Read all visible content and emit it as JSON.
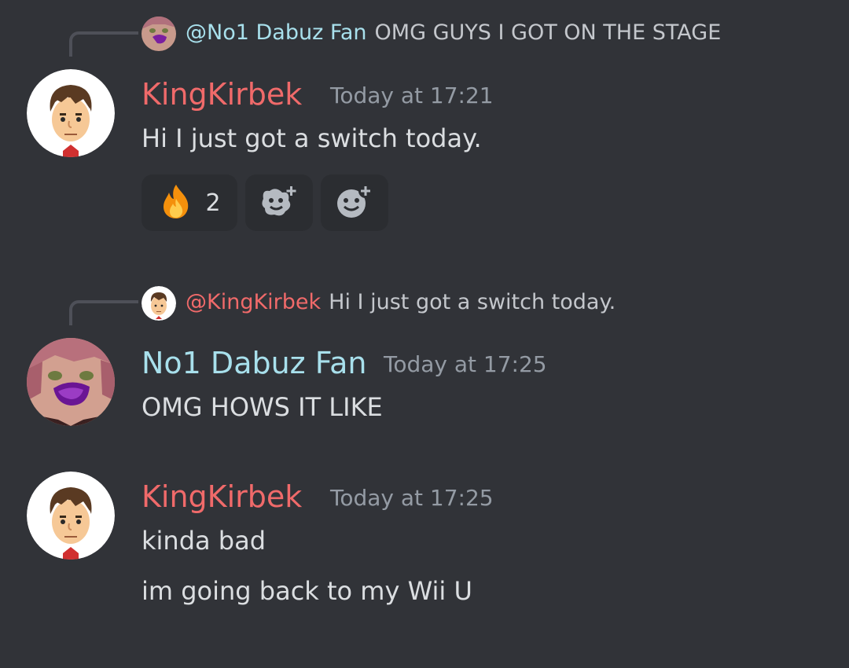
{
  "colors": {
    "background": "#313338",
    "kingkirbek_name": "#f06a6a",
    "dabuz_name": "#a8e0ec",
    "timestamp": "#949ba4",
    "message_text": "#dbdee1"
  },
  "messages": [
    {
      "reply": {
        "mention": "@No1 Dabuz Fan",
        "content": "OMG GUYS I GOT ON THE STAGE",
        "avatar_icon": "dabuz-fan-avatar"
      },
      "author": "KingKirbek",
      "timestamp": "Today at 17:21",
      "lines": [
        "Hi I just got a switch today."
      ],
      "avatar_icon": "mii-avatar",
      "reactions": [
        {
          "icon": "fire-emoji",
          "count": "2"
        },
        {
          "icon": "add-super-reaction-icon",
          "count": ""
        },
        {
          "icon": "add-reaction-icon",
          "count": ""
        }
      ]
    },
    {
      "reply": {
        "mention": "@KingKirbek",
        "content": "Hi I just got a switch today.",
        "avatar_icon": "mii-avatar"
      },
      "author": "No1 Dabuz Fan",
      "timestamp": "Today at 17:25",
      "lines": [
        "OMG HOWS IT LIKE"
      ],
      "avatar_icon": "dabuz-fan-avatar"
    },
    {
      "author": "KingKirbek",
      "timestamp": "Today at 17:25",
      "lines": [
        "kinda bad",
        "im going back to my Wii U"
      ],
      "avatar_icon": "mii-avatar"
    }
  ]
}
